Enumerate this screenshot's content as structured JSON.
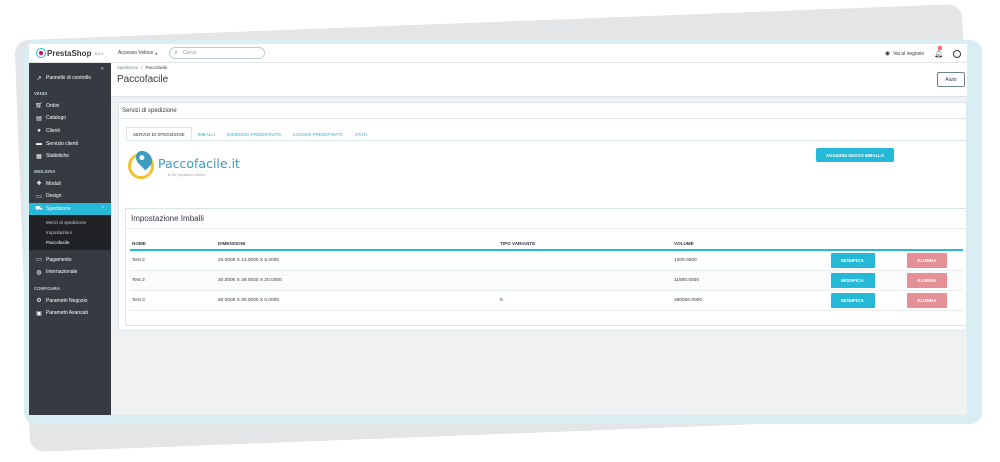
{
  "header": {
    "brand": "PrestaShop",
    "version": "8.0.1",
    "quick_access": "Accesso Veloce",
    "search_placeholder": "Cerca",
    "view_store": "Vai al negozio",
    "notifications_count": "4"
  },
  "sidebar": {
    "dashboard": "Pannello di controllo",
    "section_sell": "VENDI",
    "sell_items": [
      {
        "label": "Ordini",
        "icon": "cart-icon"
      },
      {
        "label": "Catalogo",
        "icon": "store-icon"
      },
      {
        "label": "Clienti",
        "icon": "user-icon"
      },
      {
        "label": "Servizio clienti",
        "icon": "chat-icon"
      },
      {
        "label": "Statistiche",
        "icon": "chart-icon"
      }
    ],
    "section_improve": "MIGLIORA",
    "improve_items": [
      {
        "label": "Moduli",
        "icon": "puzzle-icon"
      },
      {
        "label": "Design",
        "icon": "monitor-icon"
      }
    ],
    "active_item": "Spedizione",
    "sub_items": [
      "Mezzi di spedizione",
      "Impostazioni",
      "Paccofacile"
    ],
    "more_items": [
      {
        "label": "Pagamento",
        "icon": "card-icon"
      },
      {
        "label": "Internazionale",
        "icon": "globe-icon"
      }
    ],
    "section_configure": "CONFIGURA",
    "configure_items": [
      {
        "label": "Parametri Negozio",
        "icon": "gear-icon"
      },
      {
        "label": "Parametri Avanzati",
        "icon": "settings-box-icon"
      }
    ]
  },
  "page": {
    "breadcrumb": [
      "Spedizione",
      "Paccofacile"
    ],
    "title": "Paccofacile",
    "help_button": "Aiuto"
  },
  "card": {
    "title": "Servizi di spedizione",
    "tabs": [
      "SERVIZI DI SPEDIZIONE",
      "IMBALLI",
      "INDIRIZZO PREDEFINITO",
      "LOCKER PREDEFINITO",
      "STATI"
    ],
    "active_tab": 0,
    "brand_name": "Paccofacile.it",
    "brand_tagline": "le tue Spedizioni Online",
    "add_button": "AGGIUNGI NUOVO IMBALLO"
  },
  "packages": {
    "title": "Impostazione Imballi",
    "columns": [
      "NOME",
      "DIMENSIONI",
      "TIPO VARIANTE",
      "VOLUME"
    ],
    "rows": [
      {
        "name": "Test 2",
        "dimensions": "20.0000 X 13.0000 X 5.0000",
        "variant": "",
        "volume": "1300.0000"
      },
      {
        "name": "Test 2",
        "dimensions": "20.0000 X 29.0000 X 20.0000",
        "variant": "",
        "volume": "11600.0000"
      },
      {
        "name": "Test 3",
        "dimensions": "60.0000 X 80.0000 X 0.0000",
        "variant": "5",
        "volume": "480000.0000"
      }
    ],
    "edit_label": "MODIFICA",
    "delete_label": "ELIMINA"
  }
}
